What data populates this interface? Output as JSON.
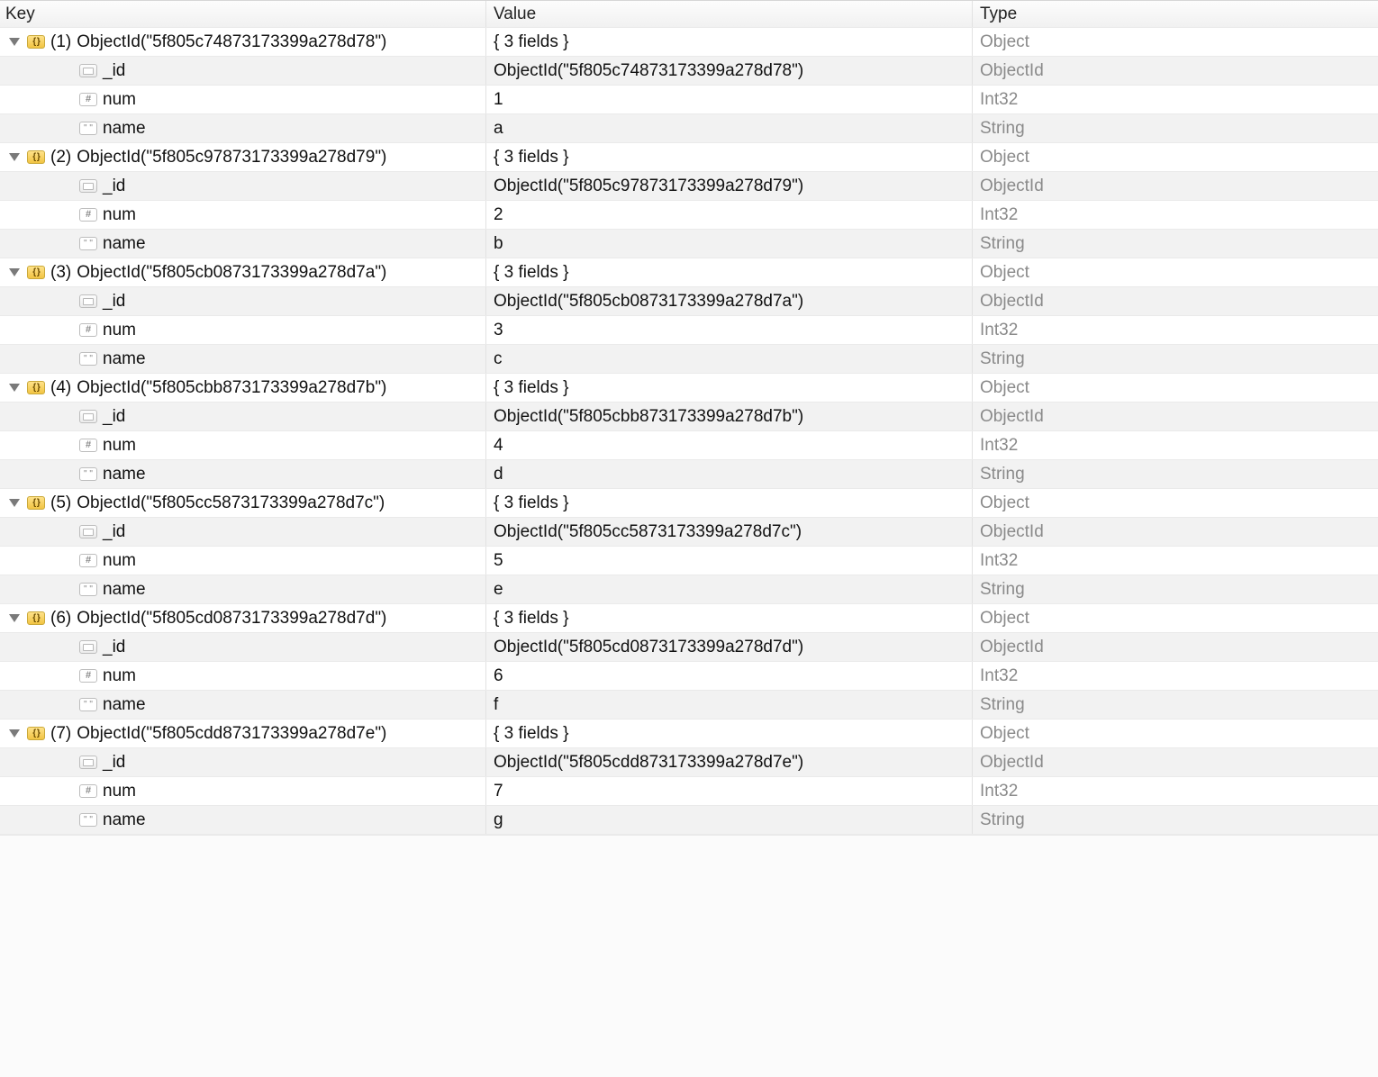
{
  "columns": {
    "key": "Key",
    "value": "Value",
    "type": "Type"
  },
  "field_summary": "{ 3 fields }",
  "types": {
    "object": "Object",
    "objectid": "ObjectId",
    "int32": "Int32",
    "string": "String"
  },
  "field_names": {
    "id": "_id",
    "num": "num",
    "name": "name"
  },
  "documents": [
    {
      "index": "(1)",
      "label": "ObjectId(\"5f805c74873173399a278d78\")",
      "id": "ObjectId(\"5f805c74873173399a278d78\")",
      "num": "1",
      "name": "a"
    },
    {
      "index": "(2)",
      "label": "ObjectId(\"5f805c97873173399a278d79\")",
      "id": "ObjectId(\"5f805c97873173399a278d79\")",
      "num": "2",
      "name": "b"
    },
    {
      "index": "(3)",
      "label": "ObjectId(\"5f805cb0873173399a278d7a\")",
      "id": "ObjectId(\"5f805cb0873173399a278d7a\")",
      "num": "3",
      "name": "c"
    },
    {
      "index": "(4)",
      "label": "ObjectId(\"5f805cbb873173399a278d7b\")",
      "id": "ObjectId(\"5f805cbb873173399a278d7b\")",
      "num": "4",
      "name": "d"
    },
    {
      "index": "(5)",
      "label": "ObjectId(\"5f805cc5873173399a278d7c\")",
      "id": "ObjectId(\"5f805cc5873173399a278d7c\")",
      "num": "5",
      "name": "e"
    },
    {
      "index": "(6)",
      "label": "ObjectId(\"5f805cd0873173399a278d7d\")",
      "id": "ObjectId(\"5f805cd0873173399a278d7d\")",
      "num": "6",
      "name": "f"
    },
    {
      "index": "(7)",
      "label": "ObjectId(\"5f805cdd873173399a278d7e\")",
      "id": "ObjectId(\"5f805cdd873173399a278d7e\")",
      "num": "7",
      "name": "g"
    }
  ]
}
